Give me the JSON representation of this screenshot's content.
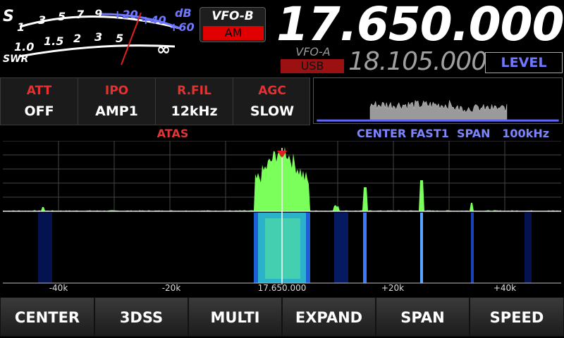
{
  "meter": {
    "s_label": "S",
    "s_scale": [
      "1",
      "3",
      "5",
      "7",
      "9"
    ],
    "db_label": "dB",
    "db_scale": [
      "+20",
      "+40",
      "+60"
    ],
    "swr_label": "SWR",
    "swr_scale": [
      "1.0",
      "1.5",
      "2",
      "3",
      "5",
      "∞"
    ],
    "needle_color": "#e02020",
    "accent_color": "#6f78ff"
  },
  "vfo_b": {
    "label": "VFO-B",
    "mode": "AM"
  },
  "main_frequency": "17.650.000",
  "vfo_a": {
    "label": "VFO-A",
    "mode": "USB",
    "frequency": "18.105.000"
  },
  "level_button": "LEVEL",
  "functions": [
    {
      "title": "ATT",
      "value": "OFF"
    },
    {
      "title": "IPO",
      "value": "AMP1"
    },
    {
      "title": "R.FIL",
      "value": "12kHz"
    },
    {
      "title": "AGC",
      "value": "SLOW"
    }
  ],
  "atas_label": "ATAS",
  "scope_info": {
    "mode": "CENTER",
    "speed": "FAST1",
    "span_label": "SPAN",
    "span_value": "100kHz"
  },
  "axis_labels": [
    "-40k",
    "-20k",
    "17.650.000",
    "+20k",
    "+40k"
  ],
  "bottom_buttons": [
    "CENTER",
    "3DSS",
    "MULTI",
    "EXPAND",
    "SPAN",
    "SPEED"
  ]
}
